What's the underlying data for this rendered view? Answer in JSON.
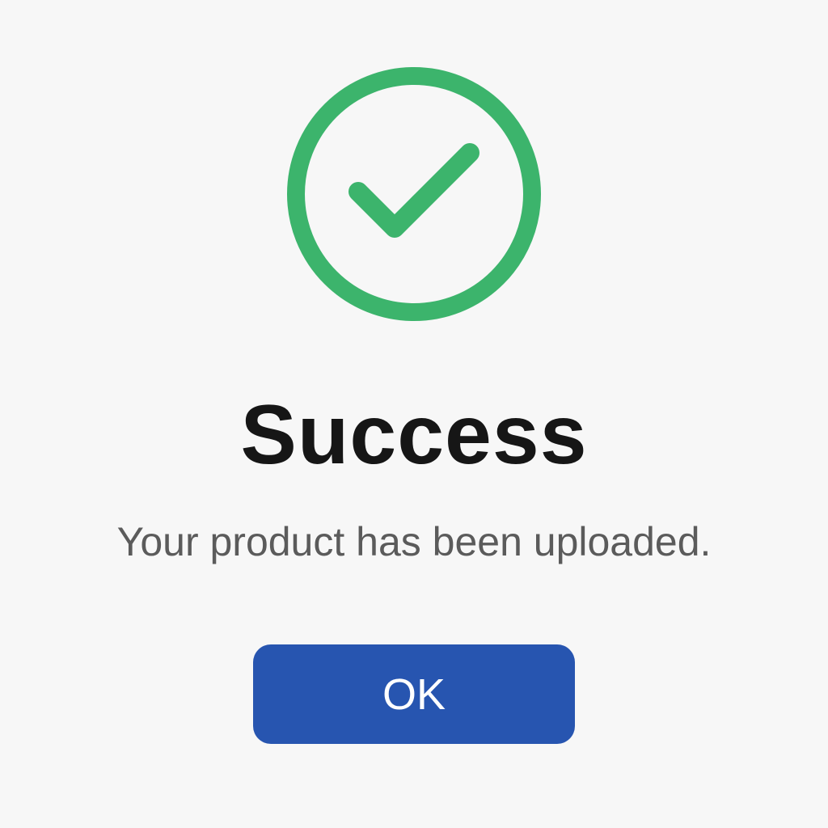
{
  "dialog": {
    "icon": "check-circle-icon",
    "title": "Success",
    "message": "Your product has been uploaded.",
    "button_label": "OK"
  },
  "colors": {
    "background": "#f7f7f7",
    "success_green": "#3cb46c",
    "button_blue": "#2755b0",
    "title_text": "#161616",
    "message_text": "#5b5b5b"
  }
}
